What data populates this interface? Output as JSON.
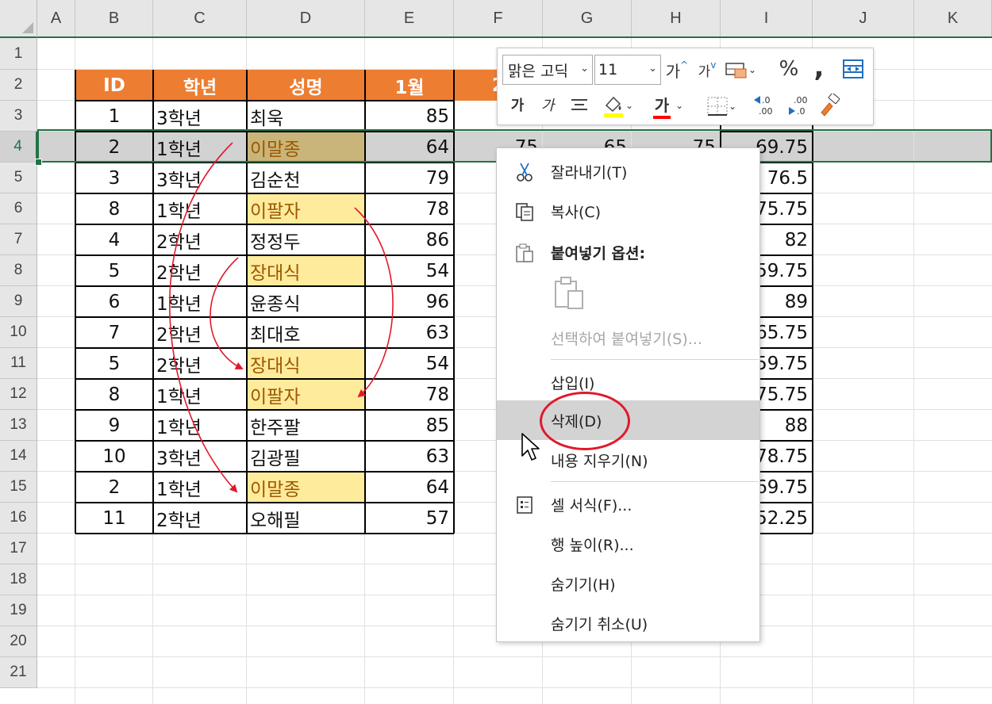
{
  "columns": [
    "A",
    "B",
    "C",
    "D",
    "E",
    "F",
    "G",
    "H",
    "I",
    "J",
    "K"
  ],
  "rows": [
    "1",
    "2",
    "3",
    "4",
    "5",
    "6",
    "7",
    "8",
    "9",
    "10",
    "11",
    "12",
    "13",
    "14",
    "15",
    "16",
    "17",
    "18",
    "19",
    "20",
    "21"
  ],
  "selected_row": "4",
  "table": {
    "headers": [
      "ID",
      "학년",
      "성명",
      "1월",
      "2"
    ],
    "data": [
      {
        "id": "1",
        "grade": "3학년",
        "name": "최욱",
        "m1": "85",
        "f": "",
        "g": "",
        "h": "",
        "i": ""
      },
      {
        "id": "2",
        "grade": "1학년",
        "name": "이말종",
        "m1": "64",
        "f": "75",
        "g": "65",
        "h": "75",
        "i": "69.75"
      },
      {
        "id": "3",
        "grade": "3학년",
        "name": "김순천",
        "m1": "79",
        "f": "",
        "g": "",
        "h": "",
        "i": "76.5"
      },
      {
        "id": "8",
        "grade": "1학년",
        "name": "이팔자",
        "m1": "78",
        "f": "",
        "g": "",
        "h": "",
        "i": "75.75"
      },
      {
        "id": "4",
        "grade": "2학년",
        "name": "정정두",
        "m1": "86",
        "f": "",
        "g": "",
        "h": "",
        "i": "82"
      },
      {
        "id": "5",
        "grade": "2학년",
        "name": "장대식",
        "m1": "54",
        "f": "",
        "g": "",
        "h": "",
        "i": "59.75"
      },
      {
        "id": "6",
        "grade": "1학년",
        "name": "윤종식",
        "m1": "96",
        "f": "",
        "g": "",
        "h": "",
        "i": "89"
      },
      {
        "id": "7",
        "grade": "2학년",
        "name": "최대호",
        "m1": "63",
        "f": "",
        "g": "",
        "h": "",
        "i": "65.75"
      },
      {
        "id": "5",
        "grade": "2학년",
        "name": "장대식",
        "m1": "54",
        "f": "",
        "g": "",
        "h": "",
        "i": "59.75"
      },
      {
        "id": "8",
        "grade": "1학년",
        "name": "이팔자",
        "m1": "78",
        "f": "",
        "g": "",
        "h": "",
        "i": "75.75"
      },
      {
        "id": "9",
        "grade": "1학년",
        "name": "한주팔",
        "m1": "85",
        "f": "",
        "g": "",
        "h": "",
        "i": "88"
      },
      {
        "id": "10",
        "grade": "3학년",
        "name": "김광필",
        "m1": "63",
        "f": "",
        "g": "",
        "h": "",
        "i": "78.75"
      },
      {
        "id": "2",
        "grade": "1학년",
        "name": "이말종",
        "m1": "64",
        "f": "",
        "g": "",
        "h": "",
        "i": "69.75"
      },
      {
        "id": "11",
        "grade": "2학년",
        "name": "오해필",
        "m1": "57",
        "f": "",
        "g": "",
        "h": "",
        "i": "52.25"
      }
    ],
    "duplicate_rows": [
      1,
      3,
      5,
      8,
      9,
      12
    ]
  },
  "mini_toolbar": {
    "font_name": "맑은 고딕",
    "font_size": "11",
    "increase_font": "가",
    "decrease_font": "가",
    "percent": "%",
    "comma": ",",
    "bold": "가",
    "italic": "가",
    "font_color_glyph": "가",
    "inc_decimal_top": ".0",
    "inc_decimal_bottom": ".00",
    "dec_decimal_top": ".00",
    "dec_decimal_bottom": ".0",
    "fill_color": "#ffff00",
    "font_color": "#ff0000"
  },
  "context_menu": {
    "cut": "잘라내기(T)",
    "copy": "복사(C)",
    "paste_options": "붙여넣기 옵션:",
    "paste_special": "선택하여 붙여넣기(S)...",
    "insert": "삽입(I)",
    "delete": "삭제(D)",
    "clear_contents": "내용 지우기(N)",
    "format_cells": "셀 서식(F)...",
    "row_height": "행 높이(R)...",
    "hide": "숨기기(H)",
    "unhide": "숨기기 취소(U)"
  },
  "colors": {
    "header_fill": "#ed7d31",
    "duplicate_fill": "#ffeb9c",
    "duplicate_text": "#9c5700",
    "selection": "#217346",
    "annotation": "#e0192b"
  }
}
